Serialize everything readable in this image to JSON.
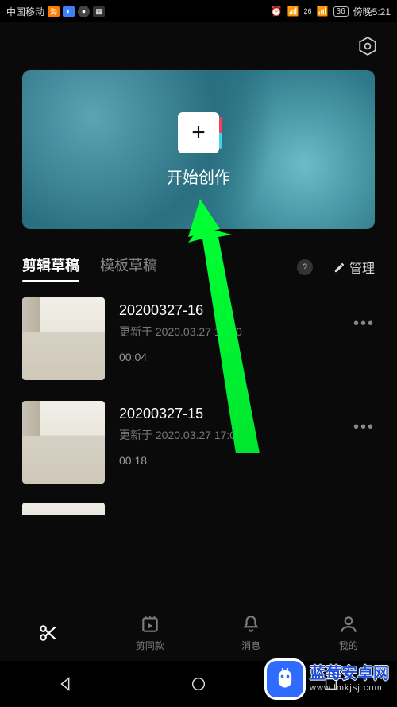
{
  "status_bar": {
    "carrier": "中国移动",
    "network": "26",
    "battery": "36",
    "time": "傍晚5:21"
  },
  "create_card": {
    "label": "开始创作"
  },
  "tabs": {
    "edit_drafts": "剪辑草稿",
    "template_drafts": "模板草稿",
    "help": "?",
    "manage": "管理"
  },
  "drafts": [
    {
      "title": "20200327-16",
      "updated": "更新于 2020.03.27 17:20",
      "duration": "00:04"
    },
    {
      "title": "20200327-15",
      "updated": "更新于 2020.03.27 17:06",
      "duration": "00:18"
    }
  ],
  "bottom_tabs": {
    "cut": "剪同款",
    "messages": "消息",
    "mine": "我的"
  },
  "watermark": {
    "main": "蓝莓安卓网",
    "sub": "www.lmkjsj.com"
  }
}
